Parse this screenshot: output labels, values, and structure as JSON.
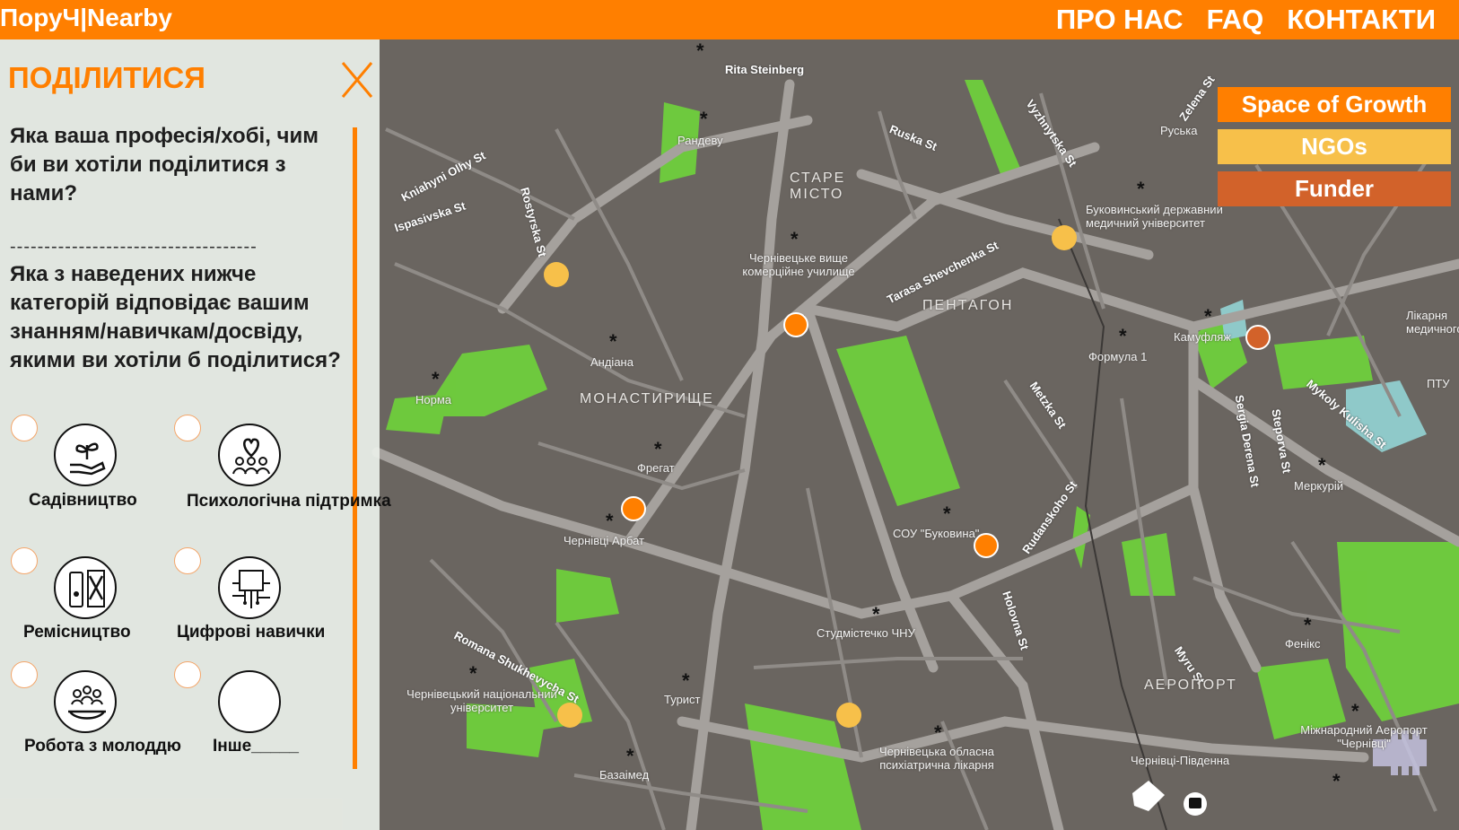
{
  "header": {
    "logo": "ПоруЧ|Nearby",
    "nav": [
      "ПРО НАС",
      "FAQ",
      "КОНТАКТИ"
    ]
  },
  "legend": {
    "items": [
      {
        "label": "Space of Growth",
        "color": "#ff7f00"
      },
      {
        "label": "NGOs",
        "color": "#f7c04a"
      },
      {
        "label": "Funder",
        "color": "#d2622a"
      }
    ]
  },
  "panel": {
    "title": "ПОДІЛИТИСЯ",
    "question1": "Яка ваша професія/хобі, чим би ви хотіли поділитися з нами?",
    "divider": "------------------------------------",
    "question2": "Яка з наведених нижче категорій відповідає вашим знанням/навичкам/досвіду, якими ви хотіли б поділитися?",
    "categories": [
      {
        "label": "Садівництво",
        "icon": "plant-hand-icon"
      },
      {
        "label": "Психологічна підтримка",
        "icon": "heart-people-icon"
      },
      {
        "label": "Ремісництво",
        "icon": "crafts-icon"
      },
      {
        "label": "Цифрові навички",
        "icon": "digital-circuit-icon"
      },
      {
        "label": "Робота з молоддю",
        "icon": "youth-group-icon"
      },
      {
        "label": "Інше_____",
        "icon": "blank-circle-icon"
      }
    ]
  },
  "map": {
    "streets": [
      "Rita Steinberg",
      "Kniahyni Olhy St",
      "Ispasivska St",
      "Rostyrska St",
      "Ruska St",
      "Vyzhnytska St",
      "Zelena St",
      "Tarasa Shevchenka St",
      "Metzka St",
      "Rudanskoho St",
      "Holovna St",
      "Romana Shukhevycha St",
      "Myru St",
      "Sergia Derena St",
      "Steporva St",
      "Mykoly Kulisha St",
      "Ruska St"
    ],
    "districts": [
      "СТАРЕ МІСТО",
      "ПЕНТАГОН",
      "МОНАСТИРИЩЕ",
      "АЕРОПОРТ"
    ],
    "places": [
      "Рандеву",
      "Руська",
      "Буковинський державний медичний університет",
      "Чернівецьке вище комерційне училище",
      "Формула 1",
      "Камуфляж",
      "Андіана",
      "Норма",
      "Фрегат",
      "Чернівці Арбат",
      "СОУ \"Буковина\"",
      "Меркурій",
      "Студмістечко ЧНУ",
      "Чернівецький національний університет",
      "Турист",
      "Базаімед",
      "Чернівецька обласна психіатрична лікарня",
      "Чернівці-Південна",
      "Фенікс",
      "Міжнародний Аеропорт \"Чернівці\"",
      "Лікарня медичного",
      "ПТУ"
    ]
  }
}
